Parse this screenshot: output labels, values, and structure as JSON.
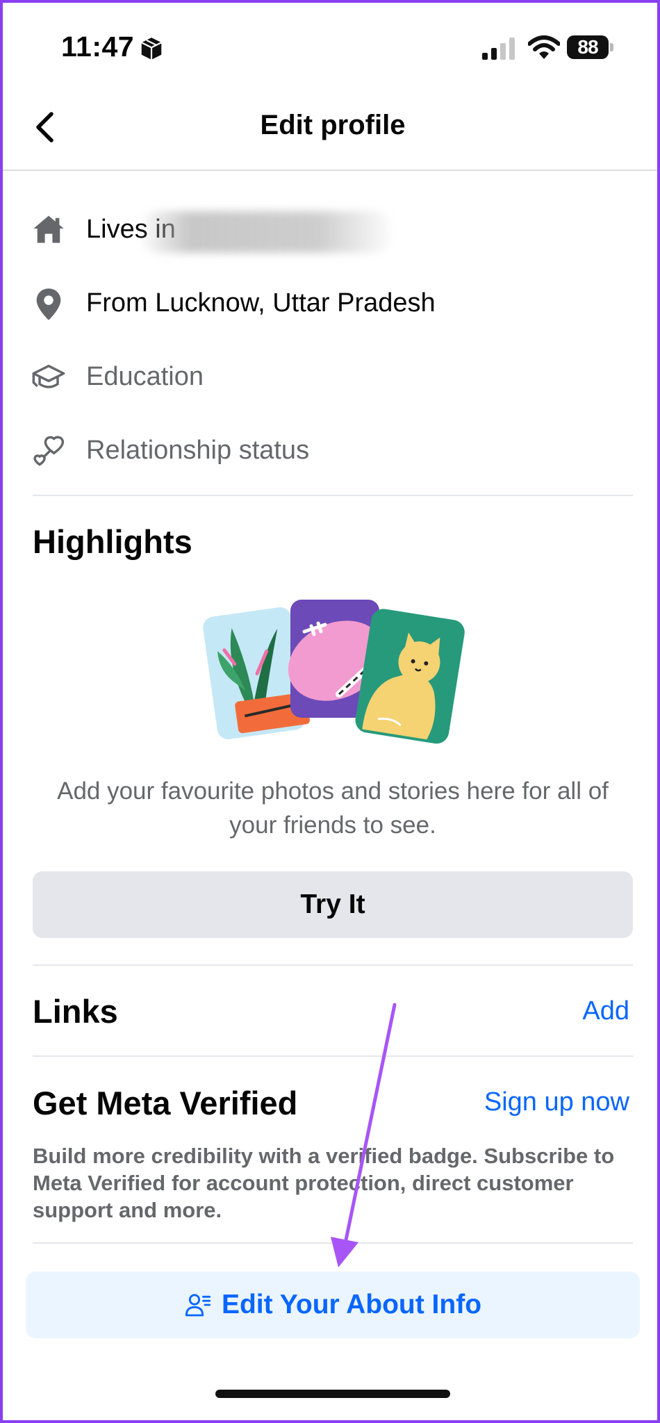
{
  "status_bar": {
    "time": "11:47",
    "battery_level": "88"
  },
  "nav": {
    "title": "Edit profile",
    "back_icon": "chevron-left-icon"
  },
  "details": {
    "lives_in_label": "Lives in",
    "hometown": "From Lucknow, Uttar Pradesh",
    "education": "Education",
    "relationship": "Relationship status"
  },
  "highlights": {
    "title": "Highlights",
    "description": "Add your favourite photos and stories here for all of your friends to see.",
    "button_label": "Try It"
  },
  "links": {
    "title": "Links",
    "action_label": "Add"
  },
  "meta_verified": {
    "title": "Get Meta Verified",
    "action_label": "Sign up now",
    "description": "Build more credibility with a verified badge. Subscribe to Meta Verified for account protection, direct customer support and more."
  },
  "about_button": {
    "label": "Edit Your About Info"
  },
  "colors": {
    "accent": "#0866ff",
    "annotation_arrow": "#a855f7",
    "frame_border": "#8a3ff0"
  }
}
